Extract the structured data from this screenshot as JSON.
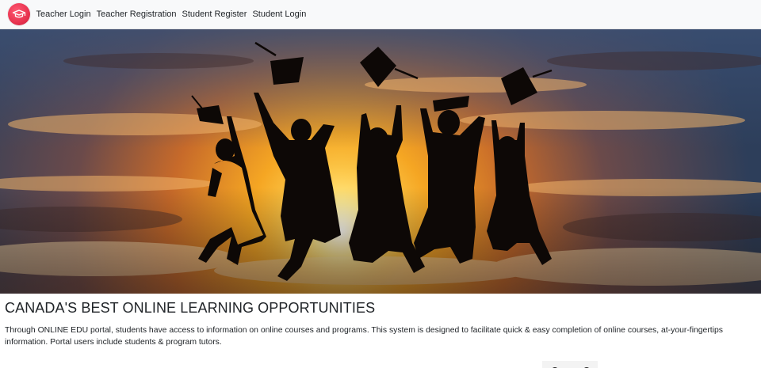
{
  "nav": {
    "links": [
      {
        "label": "Teacher Login"
      },
      {
        "label": "Teacher Registration"
      },
      {
        "label": "Student Register"
      },
      {
        "label": "Student Login"
      }
    ]
  },
  "hero": {
    "icon": "graduates-jumping-sunset-image"
  },
  "main": {
    "headline": "CANADA'S BEST ONLINE LEARNING OPPORTUNITIES",
    "description": "Through ONLINE EDU portal, students have access to information on online courses and programs. This system is designed to facilitate quick & easy completion of online courses, at-your-fingertips information. Portal users include students & program tutors."
  },
  "colors": {
    "brand": "#e8334f",
    "navbar_bg": "#f8f9fa",
    "text": "#212529"
  }
}
